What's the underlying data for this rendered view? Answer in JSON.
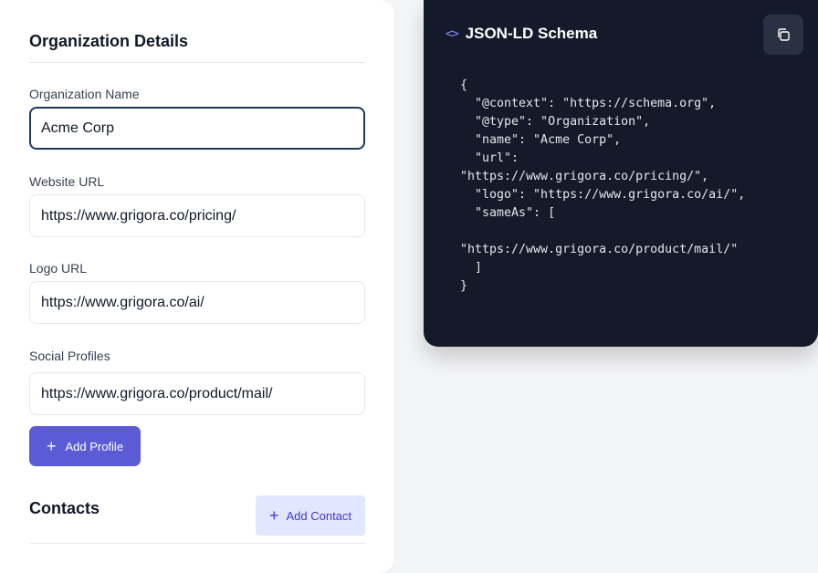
{
  "form": {
    "section_title": "Organization Details",
    "fields": [
      {
        "label": "Organization Name",
        "value": "Acme Corp"
      },
      {
        "label": "Website URL",
        "value": "https://www.grigora.co/pricing/"
      },
      {
        "label": "Logo URL",
        "value": "https://www.grigora.co/ai/"
      },
      {
        "label": "Social Profiles",
        "value": "https://www.grigora.co/product/mail/"
      }
    ],
    "add_profile_label": "Add Profile",
    "contacts_title": "Contacts",
    "add_contact_label": "Add Contact"
  },
  "code_panel": {
    "icon": "code-brackets-icon",
    "title": "JSON-LD Schema",
    "copy_icon": "copy-icon",
    "code": "{\n  \"@context\": \"https://schema.org\",\n  \"@type\": \"Organization\",\n  \"name\": \"Acme Corp\",\n  \"url\":\n\"https://www.grigora.co/pricing/\",\n  \"logo\": \"https://www.grigora.co/ai/\",\n  \"sameAs\": [\n\n\"https://www.grigora.co/product/mail/\"\n  ]\n}"
  },
  "colors": {
    "primary": "#5b5bd6",
    "secondary_bg": "#e0e7ff",
    "panel_bg": "#141a2a",
    "focus_border": "#1e3a5f"
  }
}
